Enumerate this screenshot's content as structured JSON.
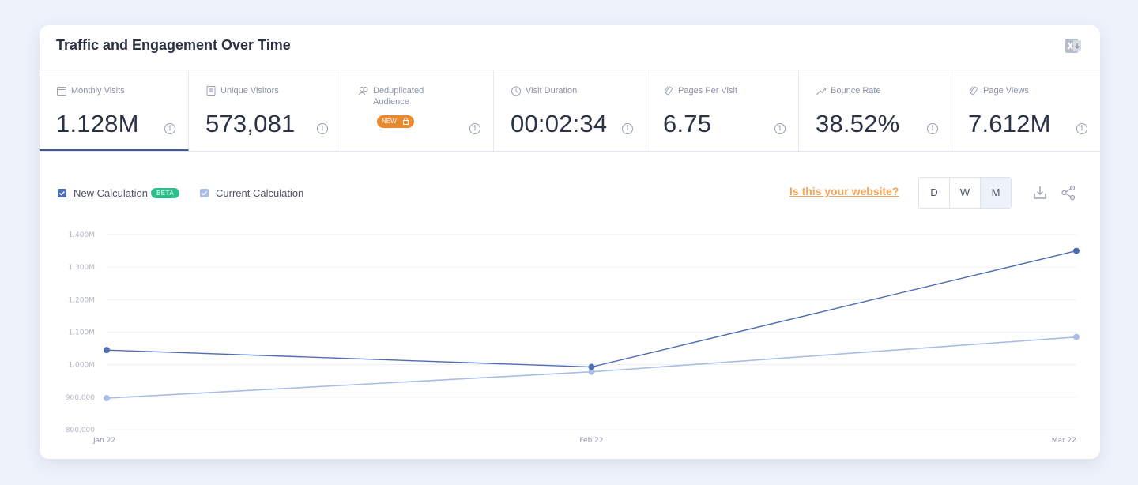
{
  "widget": {
    "title": "Traffic and Engagement Over Time"
  },
  "metrics": [
    {
      "label": "Monthly Visits",
      "value": "1.128M",
      "icon": "calendar-icon",
      "active": true
    },
    {
      "label": "Unique Visitors",
      "value": "573,081",
      "icon": "unique-visitors-icon",
      "active": false
    },
    {
      "label": "Deduplicated Audience",
      "value": "",
      "icon": "audience-icon",
      "badge": "NEW",
      "active": false
    },
    {
      "label": "Visit Duration",
      "value": "00:02:34",
      "icon": "clock-icon",
      "active": false
    },
    {
      "label": "Pages Per Visit",
      "value": "6.75",
      "icon": "pages-icon",
      "active": false
    },
    {
      "label": "Bounce Rate",
      "value": "38.52%",
      "icon": "bounce-icon",
      "active": false
    },
    {
      "label": "Page Views",
      "value": "7.612M",
      "icon": "page-views-icon",
      "active": false
    }
  ],
  "legend": {
    "new_calc": "New Calculation",
    "beta": "BETA",
    "current_calc": "Current Calculation"
  },
  "link_text": "Is this your website?",
  "range_buttons": [
    "D",
    "W",
    "M"
  ],
  "range_selected": "M",
  "colors": {
    "new": "#4f6db4",
    "current": "#a9bde6",
    "accent_orange": "#e8892f",
    "beta_green": "#2bbf8a"
  },
  "chart_data": {
    "type": "line",
    "x": [
      "Jan 22",
      "Feb 22",
      "Mar 22"
    ],
    "yticks": [
      "800,000",
      "900,000",
      "1.000M",
      "1.100M",
      "1.200M",
      "1.300M",
      "1.400M"
    ],
    "ylim": [
      800000,
      1400000
    ],
    "grid": true,
    "series": [
      {
        "name": "New Calculation",
        "values": [
          1045000,
          993000,
          1350000
        ]
      },
      {
        "name": "Current Calculation",
        "values": [
          897000,
          978000,
          1085000
        ]
      }
    ]
  }
}
